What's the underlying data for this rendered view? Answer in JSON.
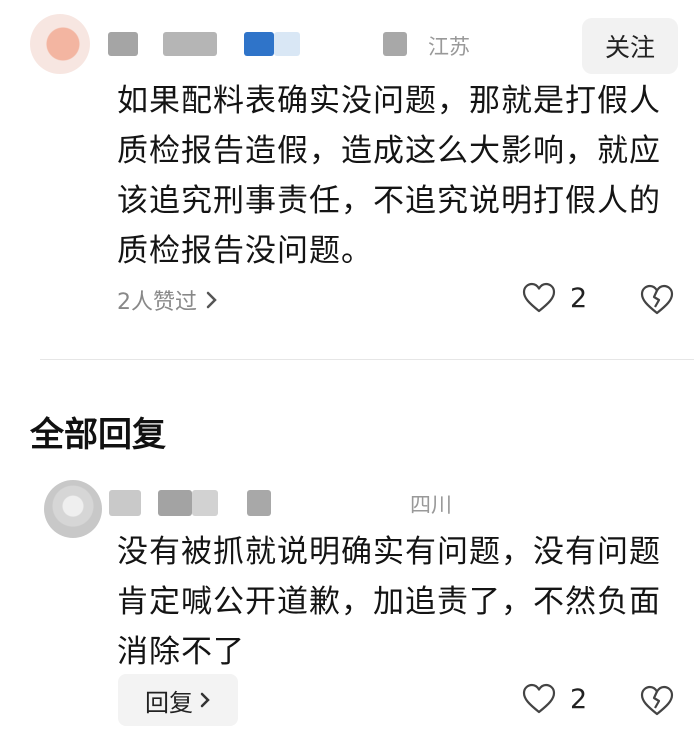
{
  "comment": {
    "location": "江苏",
    "follow_label": "关注",
    "text": "如果配料表确实没问题，那就是打假人质检报告造假，造成这么大影响，就应该追究刑事责任，不追究说明打假人的质检报告没问题。",
    "liked_by": "2人赞过",
    "like_count": "2"
  },
  "replies_section": {
    "title": "全部回复"
  },
  "reply": {
    "location": "四川",
    "text": "没有被抓就说明确实有问题，没有问题肯定喊公开道歉，加追责了，不然负面消除不了",
    "reply_label": "回复",
    "like_count": "2"
  },
  "colors": {
    "avatar_blue_block": "#2f74c9",
    "muted_text": "#999999"
  },
  "icons": [
    "chevron-right-icon",
    "heart-outline-icon",
    "broken-heart-icon"
  ]
}
